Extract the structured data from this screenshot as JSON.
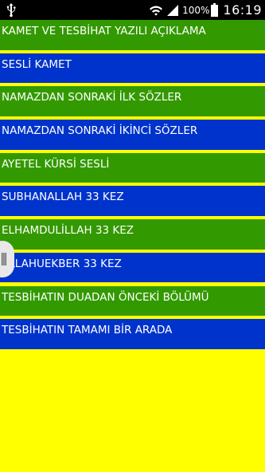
{
  "status_bar": {
    "battery_percent": "100%",
    "time": "16:19"
  },
  "menu": {
    "items": [
      {
        "label": "KAMET VE TESBİHAT YAZILI AÇIKLAMA",
        "color": "#339900"
      },
      {
        "label": "SESLİ KAMET",
        "color": "#0033cc"
      },
      {
        "label": "NAMAZDAN SONRAKİ İLK SÖZLER",
        "color": "#339900"
      },
      {
        "label": "NAMAZDAN SONRAKİ İKİNCİ SÖZLER",
        "color": "#0033cc"
      },
      {
        "label": "AYETEL KÜRSİ SESLİ",
        "color": "#339900"
      },
      {
        "label": "SUBHANALLAH 33 KEZ",
        "color": "#0033cc"
      },
      {
        "label": "ELHAMDULİLLAH 33 KEZ",
        "color": "#339900"
      },
      {
        "label": "ALLAHUEKBER 33 KEZ",
        "color": "#0033cc"
      },
      {
        "label": "TESBİHATIN DUADAN ÖNCEKİ BÖLÜMÜ",
        "color": "#339900"
      },
      {
        "label": "TESBİHATIN TAMAMI BİR ARADA",
        "color": "#0033cc"
      }
    ]
  },
  "colors": {
    "background": "#ffff00",
    "green_item": "#339900",
    "blue_item": "#0033cc",
    "status_bar": "#000000"
  },
  "icons": {
    "usb": "usb-icon",
    "wifi": "wifi-icon",
    "signal": "signal-icon",
    "battery": "battery-icon",
    "scroll_handle": "fast-scroll-handle-icon"
  }
}
